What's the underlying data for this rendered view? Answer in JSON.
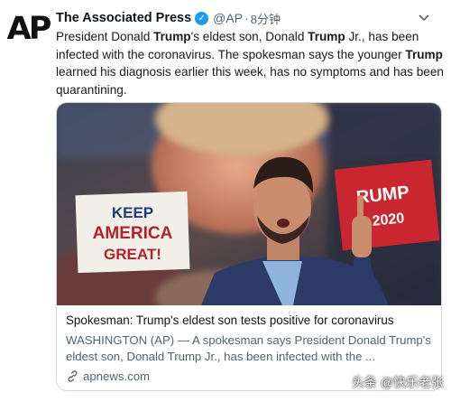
{
  "tweet": {
    "avatar_text": "AP",
    "author_name": "The Associated Press",
    "handle": "@AP",
    "separator": "·",
    "time": "8分钟",
    "text_parts": [
      "President Donald ",
      "Trump",
      "'s eldest son, Donald ",
      "Trump",
      " Jr., has been infected with the coronavirus. The spokesman says the younger ",
      "Trump",
      " learned his diagnosis earlier this week, has no symptoms and has been quarantining."
    ]
  },
  "card": {
    "photo_sign_left": [
      "KEEP",
      "AMERICA",
      "GREAT!"
    ],
    "photo_sign_right": [
      "RUMP",
      "2020"
    ],
    "title": "Spokesman: Trump's eldest son tests positive for coronavirus",
    "description": "WASHINGTON (AP) — A spokesman says President Donald Trump's eldest son, Donald Trump Jr., has been infected with the ...",
    "domain": "apnews.com"
  },
  "watermark": "头条 @快乐老张",
  "colors": {
    "verified": "#1d9bf0",
    "secondary_text": "#536471",
    "border": "#cfd9de"
  },
  "icons": {
    "verified": "verified-badge-icon",
    "menu": "chevron-down-icon",
    "link": "link-icon"
  }
}
